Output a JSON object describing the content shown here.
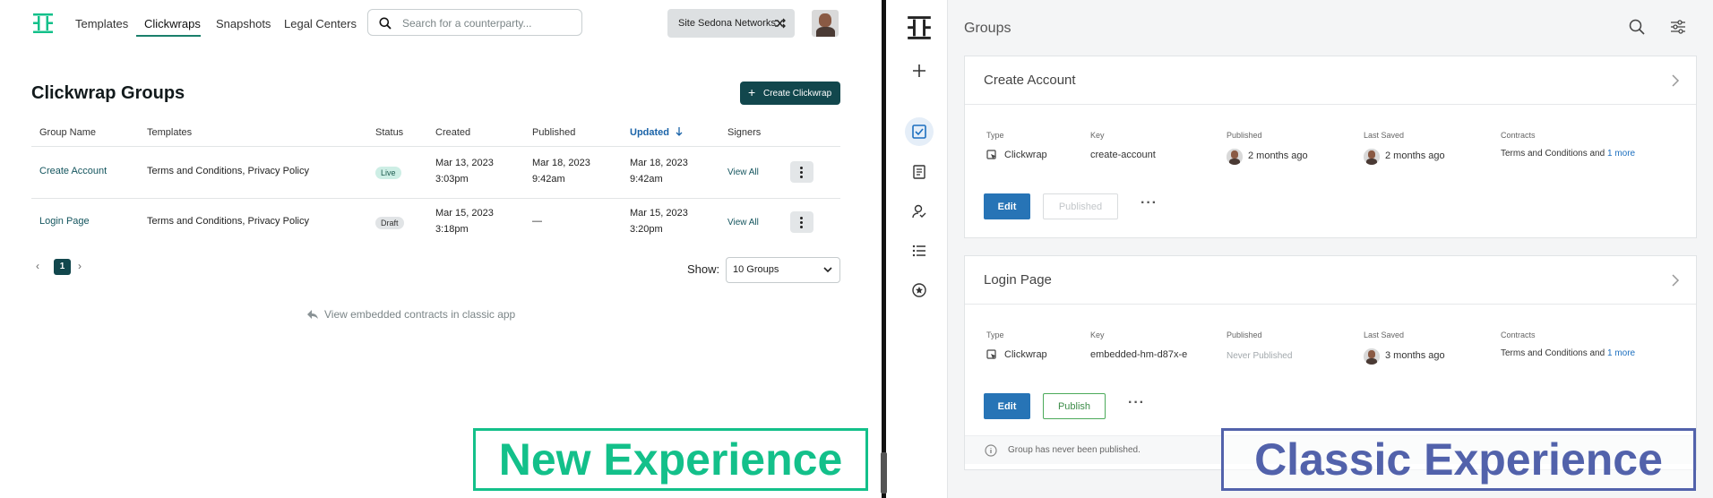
{
  "new_experience": {
    "nav": {
      "items": [
        "Templates",
        "Clickwraps",
        "Snapshots",
        "Legal Centers"
      ],
      "active": "Clickwraps",
      "search_placeholder": "Search for a counterparty...",
      "site_button": "Site Sedona Networks"
    },
    "page_title": "Clickwrap Groups",
    "create_button": "Create Clickwrap",
    "table": {
      "headers": [
        "Group Name",
        "Templates",
        "Status",
        "Created",
        "Published",
        "Updated",
        "Signers"
      ],
      "sorted_column": "Updated",
      "rows": [
        {
          "group_name": "Create Account",
          "templates": "Terms and Conditions, Privacy Policy",
          "status": "Live",
          "created_date": "Mar 13, 2023",
          "created_time": "3:03pm",
          "published_date": "Mar 18, 2023",
          "published_time": "9:42am",
          "updated_date": "Mar 18, 2023",
          "updated_time": "9:42am",
          "signers": "View All"
        },
        {
          "group_name": "Login Page",
          "templates": "Terms and Conditions, Privacy Policy",
          "status": "Draft",
          "created_date": "Mar 15, 2023",
          "created_time": "3:18pm",
          "published_date": "—",
          "published_time": "",
          "updated_date": "Mar 15, 2023",
          "updated_time": "3:20pm",
          "signers": "View All"
        }
      ]
    },
    "pagination": {
      "current_page": "1"
    },
    "show": {
      "label": "Show:",
      "value": "10 Groups"
    },
    "classic_link": "View embedded contracts in classic app",
    "experience_label": "New Experience",
    "colors": {
      "brand": "#12474d",
      "accent": "#13c08a",
      "link": "#14555e"
    }
  },
  "classic_experience": {
    "title": "Groups",
    "cards": [
      {
        "name": "Create Account",
        "type_label": "Type",
        "type_value": "Clickwrap",
        "key_label": "Key",
        "key_value": "create-account",
        "published_label": "Published",
        "published_value": "2 months ago",
        "last_saved_label": "Last Saved",
        "last_saved_value": "2 months ago",
        "contracts_label": "Contracts",
        "contracts_value": "Terms and Conditions and ",
        "contracts_more": "1 more",
        "edit_label": "Edit",
        "publish_label": "Published"
      },
      {
        "name": "Login Page",
        "type_label": "Type",
        "type_value": "Clickwrap",
        "key_label": "Key",
        "key_value": "embedded-hm-d87x-e",
        "published_label": "Published",
        "published_value": "Never Published",
        "last_saved_label": "Last Saved",
        "last_saved_value": "3 months ago",
        "contracts_label": "Contracts",
        "contracts_value": "Terms and Conditions and ",
        "contracts_more": "1 more",
        "edit_label": "Edit",
        "publish_label": "Publish",
        "notice": "Group has never been published."
      }
    ],
    "experience_label": "Classic Experience",
    "colors": {
      "primary": "#2774b6",
      "accent": "#5262ab",
      "publish": "#4caa5a"
    }
  }
}
